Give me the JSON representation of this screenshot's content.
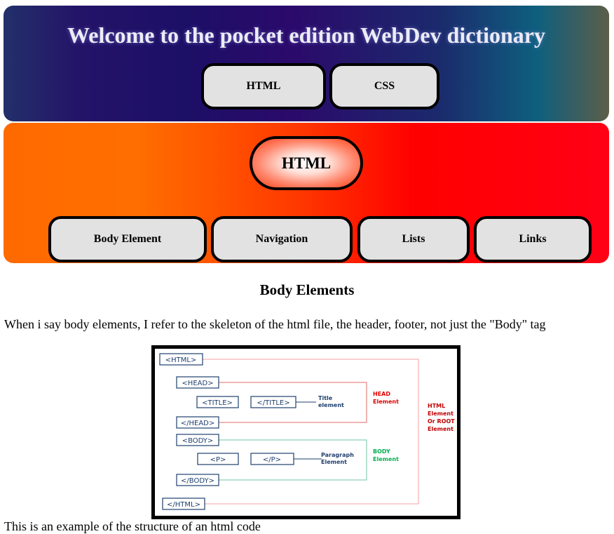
{
  "header": {
    "title": "Welcome to the pocket edition WebDev dictionary",
    "nav": [
      "HTML",
      "CSS"
    ]
  },
  "subheader": {
    "badge": "HTML",
    "tabs": [
      "Body Element",
      "Navigation",
      "Lists",
      "Links"
    ]
  },
  "main": {
    "heading": "Body Elements",
    "intro": "When i say body elements, I refer to the skeleton of the html file, the header, footer, not just the \"Body\" tag",
    "bottom_text": "This is an example of the structure of an html code"
  },
  "diagram": {
    "tags": {
      "html_open": "<HTML>",
      "head_open": "<HEAD>",
      "title_open": "<TITLE>",
      "title_close": "</TITLE>",
      "head_close": "</HEAD>",
      "body_open": "<BODY>",
      "p_open": "<P>",
      "p_close": "</P>",
      "body_close": "</BODY>",
      "html_close": "</HTML>"
    },
    "notes": {
      "title_element": [
        "Title",
        "element"
      ],
      "paragraph_element": [
        "Paragraph",
        "Element"
      ],
      "head_element": [
        "HEAD",
        "Element"
      ],
      "body_element": [
        "BODY",
        "Element"
      ],
      "root_element": [
        "HTML",
        "Element",
        "Or ROOT",
        "Element"
      ]
    },
    "colors": {
      "tag_border": "#1f3f6e",
      "head_bracket": "#e06a6a",
      "body_bracket": "#6fc6a4",
      "root_bracket": "#f4a0a0",
      "head_label": "#e00000",
      "body_label": "#00b050",
      "root_label": "#c00000",
      "note_label": "#1f3f6e"
    }
  },
  "colors": {
    "header_gradient": [
      "#23306a",
      "#1c0f66",
      "#0e5f7e",
      "#5c5e48"
    ],
    "subheader_gradient": [
      "#ff6a00",
      "#ff0000",
      "#ff0016"
    ],
    "button_bg": "#e2e2e2"
  }
}
